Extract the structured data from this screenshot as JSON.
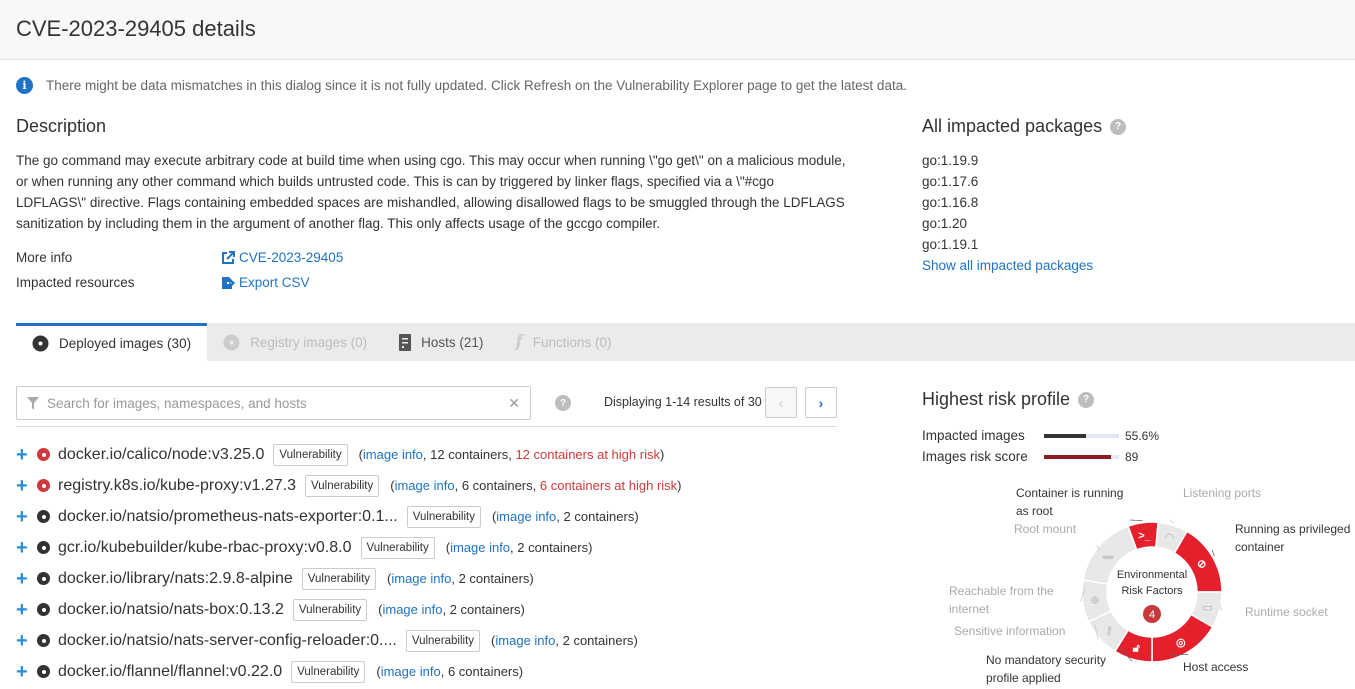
{
  "header": {
    "title": "CVE-2023-29405 details"
  },
  "notice": {
    "icon": "info-icon",
    "text": "There might be data mismatches in this dialog since it is not fully updated. Click Refresh on the Vulnerability Explorer page to get the latest data."
  },
  "description": {
    "title": "Description",
    "text": "The go command may execute arbitrary code at build time when using cgo. This may occur when running \\\"go get\\\" on a malicious module, or when running any other command which builds untrusted code. This is can by triggered by linker flags, specified via a \\\"#cgo LDFLAGS\\\" directive. Flags containing embedded spaces are mishandled, allowing disallowed flags to be smuggled through the LDFLAGS sanitization by including them in the argument of another flag. This only affects usage of the gccgo compiler."
  },
  "more_info": {
    "label": "More info",
    "link_text": "CVE-2023-29405",
    "icon": "external-link-icon"
  },
  "impacted_resources": {
    "label": "Impacted resources",
    "link_text": "Export CSV",
    "icon": "export-icon"
  },
  "packages": {
    "title": "All impacted packages",
    "items": [
      "go:1.19.9",
      "go:1.17.6",
      "go:1.16.8",
      "go:1.20",
      "go:1.19.1"
    ],
    "show_all": "Show all impacted packages"
  },
  "tabs": [
    {
      "label": "Deployed images (30)",
      "icon": "image-icon",
      "state": "active"
    },
    {
      "label": "Registry images (0)",
      "icon": "image-icon",
      "state": "disabled"
    },
    {
      "label": "Hosts (21)",
      "icon": "server-icon",
      "state": "enabled"
    },
    {
      "label": "Functions (0)",
      "icon": "function-icon",
      "state": "disabled"
    }
  ],
  "search": {
    "placeholder": "Search for images, namespaces, and hosts",
    "value": ""
  },
  "pagination": {
    "text": "Displaying 1-14 results of 30"
  },
  "colors": {
    "accent": "#1f72c4",
    "critical": "#d0393b",
    "neutral": "#333333",
    "risk_red": "#e3202b",
    "risk_gray": "#e8e8e8",
    "score_bar": "#8b1a1f"
  },
  "images": [
    {
      "name": "docker.io/calico/node:v3.25.0",
      "severity": "critical",
      "badge": "Vulnerability",
      "info": "image info",
      "containers": "12 containers",
      "risk": "12 containers at high risk"
    },
    {
      "name": "registry.k8s.io/kube-proxy:v1.27.3",
      "severity": "critical",
      "badge": "Vulnerability",
      "info": "image info",
      "containers": "6 containers",
      "risk": "6 containers at high risk"
    },
    {
      "name": "docker.io/natsio/prometheus-nats-exporter:0.1...",
      "severity": "normal",
      "badge": "Vulnerability",
      "info": "image info",
      "containers": "2 containers"
    },
    {
      "name": "gcr.io/kubebuilder/kube-rbac-proxy:v0.8.0",
      "severity": "normal",
      "badge": "Vulnerability",
      "info": "image info",
      "containers": "2 containers"
    },
    {
      "name": "docker.io/library/nats:2.9.8-alpine",
      "severity": "normal",
      "badge": "Vulnerability",
      "info": "image info",
      "containers": "2 containers"
    },
    {
      "name": "docker.io/natsio/nats-box:0.13.2",
      "severity": "normal",
      "badge": "Vulnerability",
      "info": "image info",
      "containers": "2 containers"
    },
    {
      "name": "docker.io/natsio/nats-server-config-reloader:0....",
      "severity": "normal",
      "badge": "Vulnerability",
      "info": "image info",
      "containers": "2 containers"
    },
    {
      "name": "docker.io/flannel/flannel:v0.22.0",
      "severity": "normal",
      "badge": "Vulnerability",
      "info": "image info",
      "containers": "6 containers"
    }
  ],
  "risk_profile": {
    "title": "Highest risk profile",
    "impacted_images": {
      "label": "Impacted images",
      "value": "55.6%",
      "fraction": 0.556
    },
    "risk_score": {
      "label": "Images risk score",
      "value": "89",
      "fraction": 0.89
    },
    "donut": {
      "center_line1": "Environmental",
      "center_line2": "Risk Factors",
      "count": "4",
      "factors": [
        {
          "label": "Container is running as root",
          "line1": "Container is running",
          "line2": "as root",
          "active": true,
          "icon": "terminal-icon"
        },
        {
          "label": "Listening ports",
          "line1": "Listening ports",
          "line2": "",
          "active": false,
          "icon": "wifi-icon"
        },
        {
          "label": "Running as privileged container",
          "line1": "Running as privileged",
          "line2": "container",
          "active": true,
          "icon": "eye-slash-icon"
        },
        {
          "label": "Runtime socket",
          "line1": "Runtime socket",
          "line2": "",
          "active": false,
          "icon": "socket-icon"
        },
        {
          "label": "Host access",
          "line1": "Host access",
          "line2": "",
          "active": true,
          "icon": "target-icon"
        },
        {
          "label": "No mandatory security profile applied",
          "line1": "No mandatory security",
          "line2": "profile applied",
          "active": true,
          "icon": "unlock-icon"
        },
        {
          "label": "Sensitive information",
          "line1": "Sensitive information",
          "line2": "",
          "active": false,
          "icon": "key-icon"
        },
        {
          "label": "Reachable from the internet",
          "line1": "Reachable from the",
          "line2": "internet",
          "active": false,
          "icon": "globe-icon"
        },
        {
          "label": "Root mount",
          "line1": "Root mount",
          "line2": "",
          "active": false,
          "icon": "folder-icon"
        }
      ]
    }
  }
}
